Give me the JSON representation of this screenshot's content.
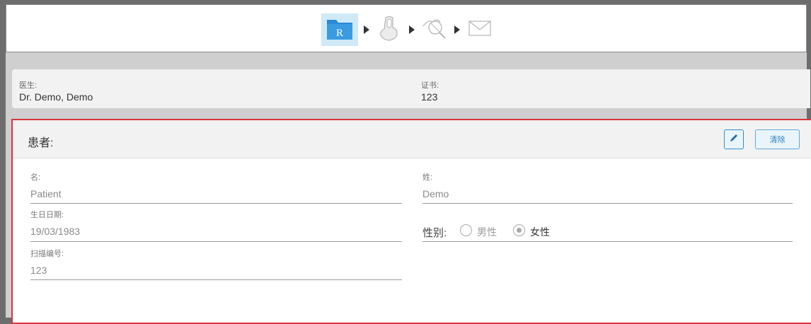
{
  "workflow": {
    "steps": [
      {
        "name": "Rx",
        "icon": "rx-folder-icon",
        "active": true,
        "glyph": "R"
      },
      {
        "name": "Scan",
        "icon": "scan-hand-icon",
        "active": false
      },
      {
        "name": "View",
        "icon": "view-magnifier-icon",
        "active": false
      },
      {
        "name": "Send",
        "icon": "send-envelope-icon",
        "active": false
      }
    ],
    "accent": "#cfe9f7"
  },
  "doctor": {
    "doctor_label": "医生:",
    "doctor_name": "Dr. Demo, Demo",
    "license_label": "证书:",
    "license_number": "123"
  },
  "patient": {
    "title": "患者:",
    "clear_label": "清除",
    "first_name_label": "名:",
    "first_name_value": "Patient",
    "last_name_label": "姓:",
    "last_name_value": "Demo",
    "dob_label": "生日日期:",
    "dob_value": "19/03/1983",
    "scan_id_label": "扫描编号:",
    "scan_id_value": "123",
    "gender_label": "性别:",
    "gender_options": [
      {
        "label": "男性",
        "selected": false
      },
      {
        "label": "女性",
        "selected": true
      }
    ],
    "highlight_color": "#d8343c"
  }
}
